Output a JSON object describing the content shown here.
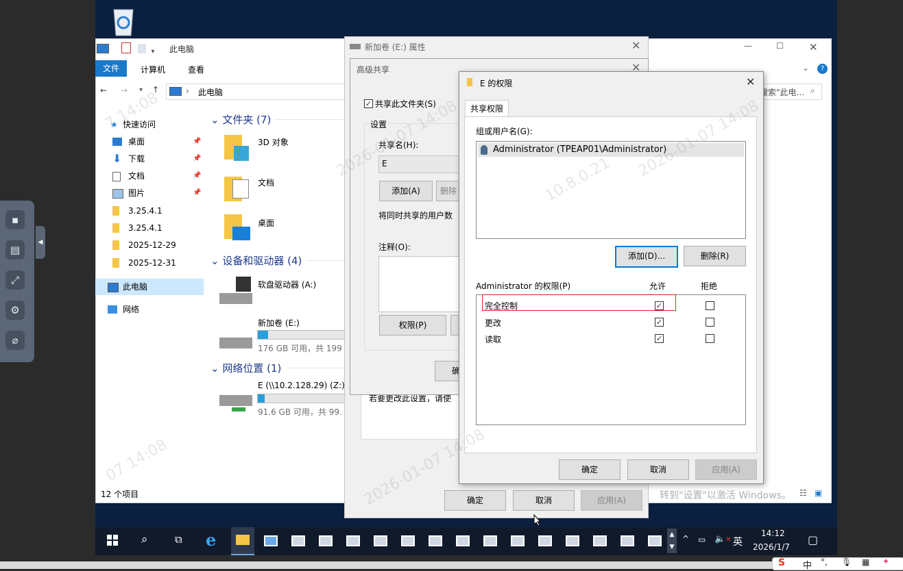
{
  "explorer": {
    "title": "此电脑",
    "ribbon_tabs": [
      "文件",
      "计算机",
      "查看"
    ],
    "address": "此电脑",
    "search_placeholder": "搜索\"此电...",
    "nav": {
      "quick_access": "快速访问",
      "items": [
        {
          "label": "桌面",
          "icon": "desktop-icon"
        },
        {
          "label": "下载",
          "icon": "download-icon"
        },
        {
          "label": "文档",
          "icon": "document-icon"
        },
        {
          "label": "图片",
          "icon": "picture-icon"
        },
        {
          "label": "3.25.4.1",
          "icon": "folder-icon"
        },
        {
          "label": "3.25.4.1",
          "icon": "folder-icon"
        },
        {
          "label": "2025-12-29",
          "icon": "folder-icon"
        },
        {
          "label": "2025-12-31",
          "icon": "folder-icon"
        }
      ],
      "this_pc": "此电脑",
      "network": "网络"
    },
    "sections": {
      "folders": "文件夹 (7)",
      "devices": "设备和驱动器 (4)",
      "network_locations": "网络位置 (1)"
    },
    "folders": [
      "3D 对象",
      "文档",
      "桌面"
    ],
    "drives": [
      {
        "name": "软盘驱动器 (A:)"
      },
      {
        "name": "新加卷 (E:)",
        "free": "176 GB 可用，共 199",
        "used_fraction": 0.12
      }
    ],
    "net_drive": {
      "name": "E (\\\\10.2.128.29) (Z:)",
      "free": "91.6 GB 可用，共 99.",
      "used_fraction": 0.08
    },
    "status": "12 个项目",
    "activate_line1": "激活 Windows",
    "activate_line2": "转到\"设置\"以激活 Windows。"
  },
  "props_dialog": {
    "title": "新加卷 (E:) 属性",
    "ok": "确定",
    "cancel": "取消",
    "apply": "应用(A)",
    "note": "若要更改此设置，请使"
  },
  "adv_share": {
    "title": "高级共享",
    "share_checkbox": "共享此文件夹(S)",
    "share_checked": true,
    "settings": "设置",
    "share_name_label": "共享名(H):",
    "share_name_value": "E",
    "add": "添加(A)",
    "remove": "删除",
    "limit_label": "将同时共享的用户数",
    "comment_label": "注释(O):",
    "permissions": "权限(P)",
    "hidden_ok": "确"
  },
  "perm_dialog": {
    "title": "E 的权限",
    "tab": "共享权限",
    "group_label": "组或用户名(G):",
    "users": [
      "Administrator (TPEAP01\\Administrator)"
    ],
    "add": "添加(D)...",
    "remove": "删除(R)",
    "perm_label": "Administrator 的权限(P)",
    "allow": "允许",
    "deny": "拒绝",
    "rows": [
      {
        "name": "完全控制",
        "allow": true,
        "deny": false
      },
      {
        "name": "更改",
        "allow": true,
        "deny": false
      },
      {
        "name": "读取",
        "allow": true,
        "deny": false
      }
    ],
    "ok": "确定",
    "cancel": "取消",
    "apply": "应用(A)"
  },
  "taskbar": {
    "time": "14:12",
    "date": "2026/1/7",
    "ime": "英"
  },
  "ime_bar": {
    "label": "中"
  },
  "colors": {
    "accent": "#1979ca",
    "highlight_box": "#e02020",
    "selection": "#cce8ff"
  }
}
